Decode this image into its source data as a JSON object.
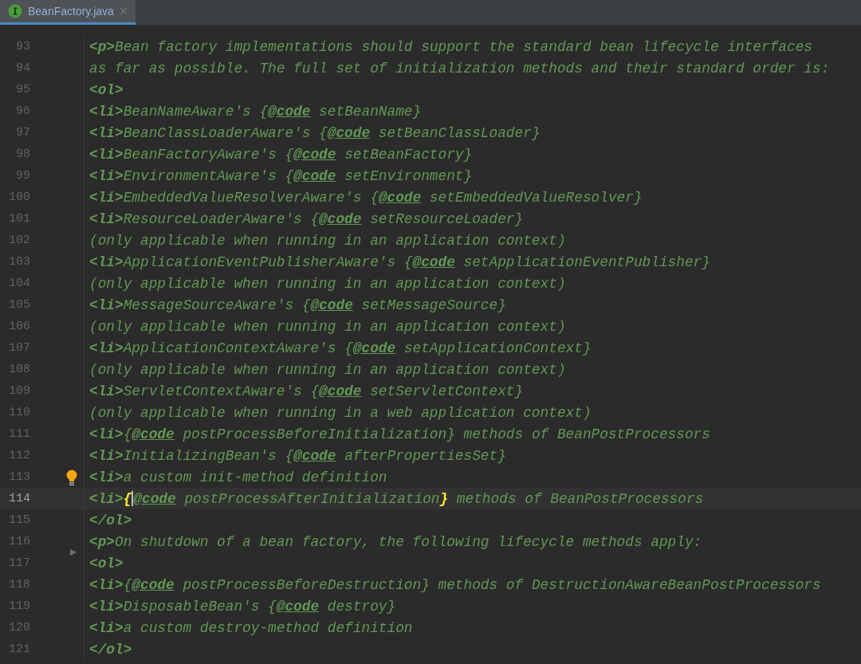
{
  "tab": {
    "title": "BeanFactory.java",
    "selected": true
  },
  "lines": [
    {
      "number": "93",
      "current": false,
      "bulb": false,
      "fold": false,
      "segments": [
        {
          "kind": "tag",
          "text": "<p>"
        },
        {
          "kind": "text",
          "text": "Bean factory implementations should support the standard bean lifecycle interfaces"
        }
      ]
    },
    {
      "number": "94",
      "current": false,
      "bulb": false,
      "fold": false,
      "segments": [
        {
          "kind": "text",
          "text": "as far as possible. The full set of initialization methods and their standard order is:"
        }
      ]
    },
    {
      "number": "95",
      "current": false,
      "bulb": false,
      "fold": false,
      "segments": [
        {
          "kind": "tag",
          "text": "<ol>"
        }
      ]
    },
    {
      "number": "96",
      "current": false,
      "bulb": false,
      "fold": false,
      "segments": [
        {
          "kind": "tag",
          "text": "<li>"
        },
        {
          "kind": "text",
          "text": "BeanNameAware's {"
        },
        {
          "kind": "doctag",
          "text": "@code"
        },
        {
          "kind": "text",
          "text": " setBeanName}"
        }
      ]
    },
    {
      "number": "97",
      "current": false,
      "bulb": false,
      "fold": false,
      "segments": [
        {
          "kind": "tag",
          "text": "<li>"
        },
        {
          "kind": "text",
          "text": "BeanClassLoaderAware's {"
        },
        {
          "kind": "doctag",
          "text": "@code"
        },
        {
          "kind": "text",
          "text": " setBeanClassLoader}"
        }
      ]
    },
    {
      "number": "98",
      "current": false,
      "bulb": false,
      "fold": false,
      "segments": [
        {
          "kind": "tag",
          "text": "<li>"
        },
        {
          "kind": "text",
          "text": "BeanFactoryAware's {"
        },
        {
          "kind": "doctag",
          "text": "@code"
        },
        {
          "kind": "text",
          "text": " setBeanFactory}"
        }
      ]
    },
    {
      "number": "99",
      "current": false,
      "bulb": false,
      "fold": false,
      "segments": [
        {
          "kind": "tag",
          "text": "<li>"
        },
        {
          "kind": "text",
          "text": "EnvironmentAware's {"
        },
        {
          "kind": "doctag",
          "text": "@code"
        },
        {
          "kind": "text",
          "text": " setEnvironment}"
        }
      ]
    },
    {
      "number": "100",
      "current": false,
      "bulb": false,
      "fold": false,
      "segments": [
        {
          "kind": "tag",
          "text": "<li>"
        },
        {
          "kind": "text",
          "text": "EmbeddedValueResolverAware's {"
        },
        {
          "kind": "doctag",
          "text": "@code"
        },
        {
          "kind": "text",
          "text": " setEmbeddedValueResolver}"
        }
      ]
    },
    {
      "number": "101",
      "current": false,
      "bulb": false,
      "fold": false,
      "segments": [
        {
          "kind": "tag",
          "text": "<li>"
        },
        {
          "kind": "text",
          "text": "ResourceLoaderAware's {"
        },
        {
          "kind": "doctag",
          "text": "@code"
        },
        {
          "kind": "text",
          "text": " setResourceLoader}"
        }
      ]
    },
    {
      "number": "102",
      "current": false,
      "bulb": false,
      "fold": false,
      "segments": [
        {
          "kind": "text",
          "text": "(only applicable when running in an application context)"
        }
      ]
    },
    {
      "number": "103",
      "current": false,
      "bulb": false,
      "fold": false,
      "segments": [
        {
          "kind": "tag",
          "text": "<li>"
        },
        {
          "kind": "text",
          "text": "ApplicationEventPublisherAware's {"
        },
        {
          "kind": "doctag",
          "text": "@code"
        },
        {
          "kind": "text",
          "text": " setApplicationEventPublisher}"
        }
      ]
    },
    {
      "number": "104",
      "current": false,
      "bulb": false,
      "fold": false,
      "segments": [
        {
          "kind": "text",
          "text": "(only applicable when running in an application context)"
        }
      ]
    },
    {
      "number": "105",
      "current": false,
      "bulb": false,
      "fold": false,
      "segments": [
        {
          "kind": "tag",
          "text": "<li>"
        },
        {
          "kind": "text",
          "text": "MessageSourceAware's {"
        },
        {
          "kind": "doctag",
          "text": "@code"
        },
        {
          "kind": "text",
          "text": " setMessageSource}"
        }
      ]
    },
    {
      "number": "106",
      "current": false,
      "bulb": false,
      "fold": false,
      "segments": [
        {
          "kind": "text",
          "text": "(only applicable when running in an application context)"
        }
      ]
    },
    {
      "number": "107",
      "current": false,
      "bulb": false,
      "fold": false,
      "segments": [
        {
          "kind": "tag",
          "text": "<li>"
        },
        {
          "kind": "text",
          "text": "ApplicationContextAware's {"
        },
        {
          "kind": "doctag",
          "text": "@code"
        },
        {
          "kind": "text",
          "text": " setApplicationContext}"
        }
      ]
    },
    {
      "number": "108",
      "current": false,
      "bulb": false,
      "fold": false,
      "segments": [
        {
          "kind": "text",
          "text": "(only applicable when running in an application context)"
        }
      ]
    },
    {
      "number": "109",
      "current": false,
      "bulb": false,
      "fold": false,
      "segments": [
        {
          "kind": "tag",
          "text": "<li>"
        },
        {
          "kind": "text",
          "text": "ServletContextAware's {"
        },
        {
          "kind": "doctag",
          "text": "@code"
        },
        {
          "kind": "text",
          "text": " setServletContext}"
        }
      ]
    },
    {
      "number": "110",
      "current": false,
      "bulb": false,
      "fold": false,
      "segments": [
        {
          "kind": "text",
          "text": "(only applicable when running in a web application context)"
        }
      ]
    },
    {
      "number": "111",
      "current": false,
      "bulb": false,
      "fold": false,
      "segments": [
        {
          "kind": "tag",
          "text": "<li>"
        },
        {
          "kind": "text",
          "text": "{"
        },
        {
          "kind": "doctag",
          "text": "@code"
        },
        {
          "kind": "text",
          "text": " postProcessBeforeInitialization} methods of BeanPostProcessors"
        }
      ]
    },
    {
      "number": "112",
      "current": false,
      "bulb": false,
      "fold": false,
      "segments": [
        {
          "kind": "tag",
          "text": "<li>"
        },
        {
          "kind": "text",
          "text": "InitializingBean's {"
        },
        {
          "kind": "doctag",
          "text": "@code"
        },
        {
          "kind": "text",
          "text": " afterPropertiesSet}"
        }
      ]
    },
    {
      "number": "113",
      "current": false,
      "bulb": true,
      "fold": false,
      "segments": [
        {
          "kind": "tag",
          "text": "<li>"
        },
        {
          "kind": "text",
          "text": "a custom init-method definition"
        }
      ]
    },
    {
      "number": "114",
      "current": true,
      "bulb": false,
      "fold": false,
      "segments": [
        {
          "kind": "tag",
          "text": "<li>"
        },
        {
          "kind": "brace",
          "text": "{",
          "caret": true
        },
        {
          "kind": "doctag",
          "text": "@code"
        },
        {
          "kind": "text",
          "text": " postProcessAfterInitialization"
        },
        {
          "kind": "brace",
          "text": "}",
          "caret": false
        },
        {
          "kind": "text",
          "text": " methods of BeanPostProcessors"
        }
      ]
    },
    {
      "number": "115",
      "current": false,
      "bulb": false,
      "fold": false,
      "segments": [
        {
          "kind": "tag",
          "text": "</ol>"
        }
      ]
    },
    {
      "number": "116",
      "current": false,
      "bulb": false,
      "fold": true,
      "segments": [
        {
          "kind": "tag",
          "text": "<p>"
        },
        {
          "kind": "text",
          "text": "On shutdown of a bean factory, the following lifecycle methods apply:"
        }
      ]
    },
    {
      "number": "117",
      "current": false,
      "bulb": false,
      "fold": false,
      "segments": [
        {
          "kind": "tag",
          "text": "<ol>"
        }
      ]
    },
    {
      "number": "118",
      "current": false,
      "bulb": false,
      "fold": false,
      "segments": [
        {
          "kind": "tag",
          "text": "<li>"
        },
        {
          "kind": "text",
          "text": "{"
        },
        {
          "kind": "doctag",
          "text": "@code"
        },
        {
          "kind": "text",
          "text": " postProcessBeforeDestruction} methods of DestructionAwareBeanPostProcessors"
        }
      ]
    },
    {
      "number": "119",
      "current": false,
      "bulb": false,
      "fold": false,
      "segments": [
        {
          "kind": "tag",
          "text": "<li>"
        },
        {
          "kind": "text",
          "text": "DisposableBean's {"
        },
        {
          "kind": "doctag",
          "text": "@code"
        },
        {
          "kind": "text",
          "text": " destroy}"
        }
      ]
    },
    {
      "number": "120",
      "current": false,
      "bulb": false,
      "fold": false,
      "segments": [
        {
          "kind": "tag",
          "text": "<li>"
        },
        {
          "kind": "text",
          "text": "a custom destroy-method definition"
        }
      ]
    },
    {
      "number": "121",
      "current": false,
      "bulb": false,
      "fold": false,
      "segments": [
        {
          "kind": "tag",
          "text": "</ol>"
        }
      ]
    }
  ]
}
